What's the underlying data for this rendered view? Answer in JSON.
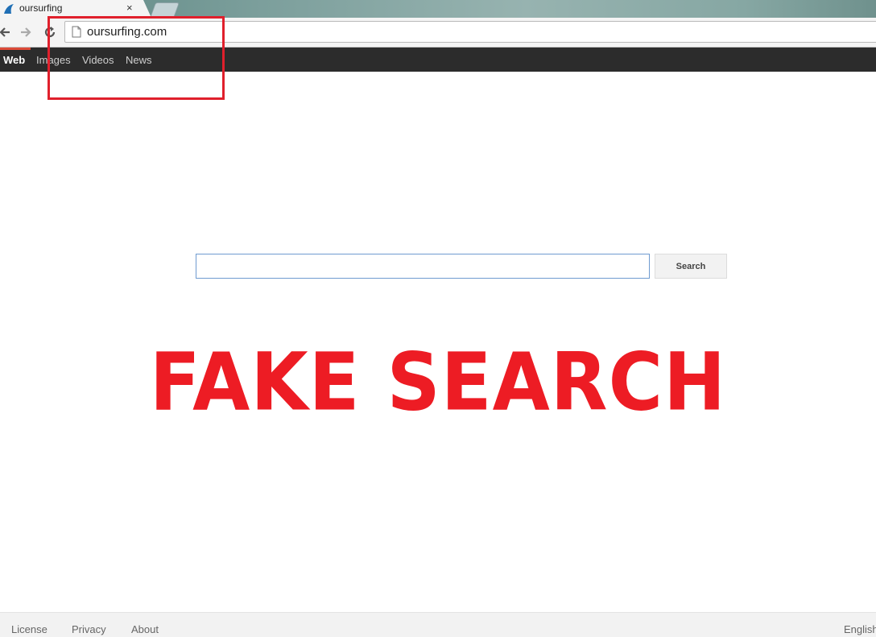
{
  "tab": {
    "title": "oursurfing",
    "close_label": "×"
  },
  "address_bar": {
    "url": "oursurfing.com"
  },
  "site_nav": {
    "items": [
      {
        "label": "Web"
      },
      {
        "label": "Images"
      },
      {
        "label": "Videos"
      },
      {
        "label": "News"
      }
    ]
  },
  "search": {
    "value": "",
    "button_label": "Search"
  },
  "overlay": {
    "label": "FAKE SEARCH",
    "color": "#ed1c24"
  },
  "footer": {
    "links": [
      {
        "label": "License"
      },
      {
        "label": "Privacy"
      },
      {
        "label": "About"
      }
    ],
    "language": "English"
  },
  "icons": {
    "favicon": "shark-fin-icon",
    "back": "back-arrow-icon",
    "forward": "forward-arrow-icon",
    "reload": "reload-icon",
    "page": "page-icon"
  },
  "colors": {
    "nav_bar": "#2c2c2c",
    "nav_active_accent": "#dd4b39",
    "annotation": "#e0202c"
  }
}
